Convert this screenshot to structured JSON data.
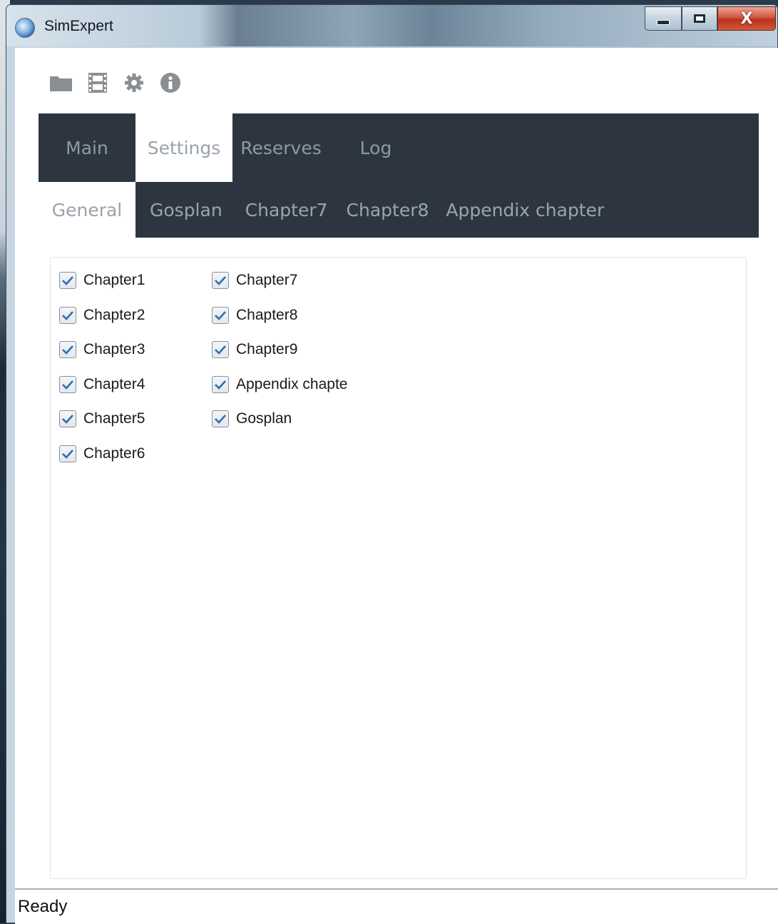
{
  "window": {
    "title": "SimExpert",
    "controls": {
      "minimize_icon": "minimize-icon",
      "maximize_icon": "maximize-icon",
      "close_label": "X"
    }
  },
  "toolbar": {
    "icons": [
      "folder-icon",
      "film-icon",
      "gear-icon",
      "info-icon"
    ]
  },
  "main_tabs": [
    {
      "label": "Main",
      "active": false
    },
    {
      "label": "Settings",
      "active": true
    },
    {
      "label": "Reserves",
      "active": false
    },
    {
      "label": "Log",
      "active": false
    }
  ],
  "sub_tabs": [
    {
      "label": "General",
      "active": true
    },
    {
      "label": "Gosplan",
      "active": false
    },
    {
      "label": "Chapter7",
      "active": false
    },
    {
      "label": "Chapter8",
      "active": false
    },
    {
      "label": "Appendix chapter",
      "active": false
    }
  ],
  "checkboxes": {
    "column1": [
      {
        "label": "Chapter1",
        "checked": true
      },
      {
        "label": "Chapter2",
        "checked": true
      },
      {
        "label": "Chapter3",
        "checked": true
      },
      {
        "label": "Chapter4",
        "checked": true
      },
      {
        "label": "Chapter5",
        "checked": true
      },
      {
        "label": "Chapter6",
        "checked": true
      }
    ],
    "column2": [
      {
        "label": "Chapter7",
        "checked": true
      },
      {
        "label": "Chapter8",
        "checked": true
      },
      {
        "label": "Chapter9",
        "checked": true
      },
      {
        "label": "Appendix chapte",
        "checked": true
      },
      {
        "label": "Gosplan",
        "checked": true
      }
    ]
  },
  "status": {
    "text": "Ready"
  },
  "colors": {
    "tab_bar": "#2d3640",
    "check_mark": "#2a6fb0"
  }
}
